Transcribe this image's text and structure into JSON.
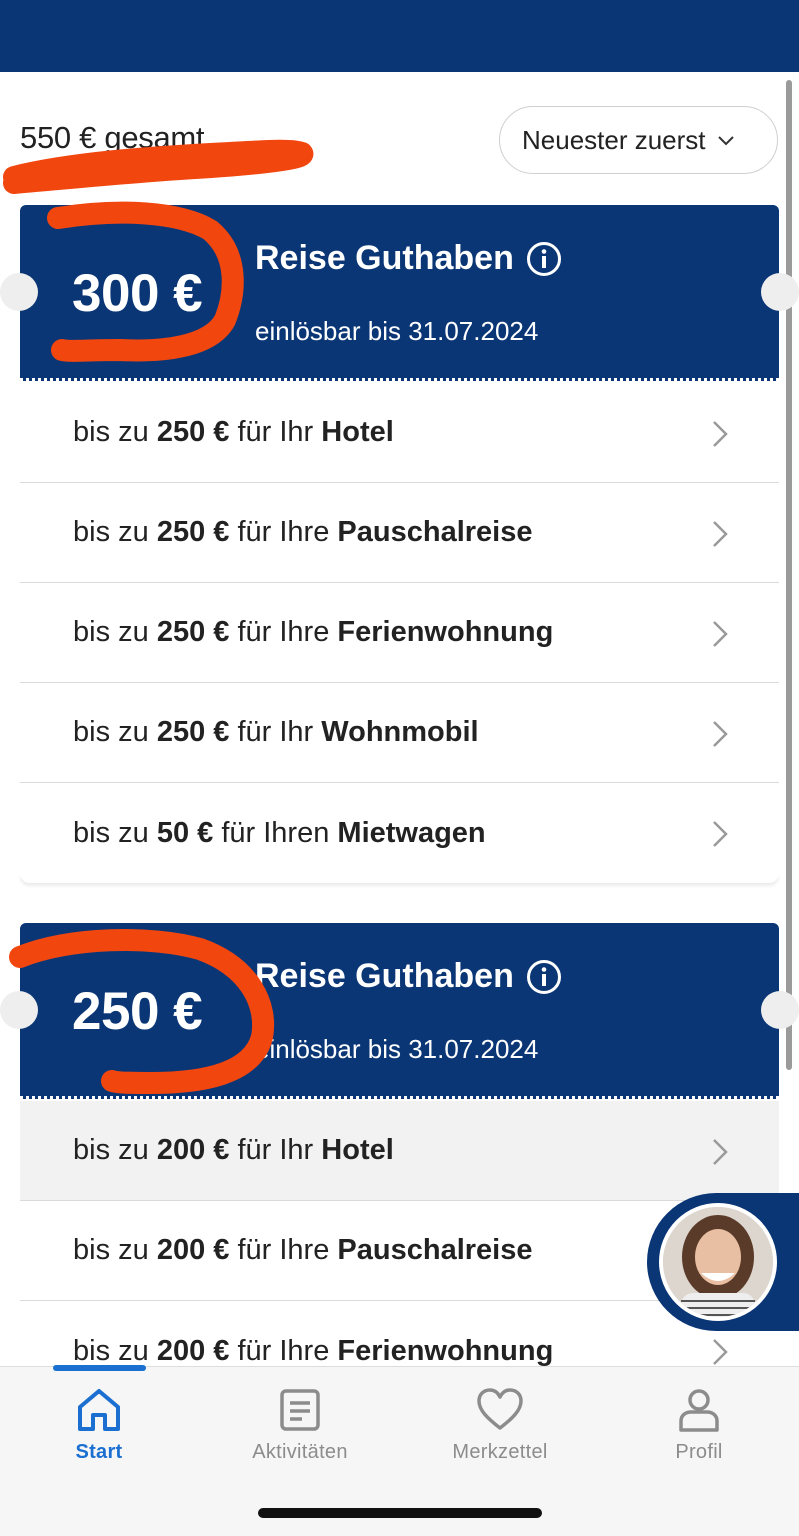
{
  "header": {
    "total": "550 € gesamt",
    "sort_label": "Neuester zuerst",
    "sort_icon": "chevron-down-icon"
  },
  "vouchers": [
    {
      "amount": "300 €",
      "title": "Reise Guthaben",
      "valid": "einlösbar bis 31.07.2024",
      "items": [
        {
          "pre": "bis zu",
          "amount": "250 €",
          "mid": "für Ihr",
          "target": "Hotel"
        },
        {
          "pre": "bis zu",
          "amount": "250 €",
          "mid": "für Ihre",
          "target": "Pauschalreise"
        },
        {
          "pre": "bis zu",
          "amount": "250 €",
          "mid": "für Ihre",
          "target": "Ferienwohnung"
        },
        {
          "pre": "bis zu",
          "amount": "250 €",
          "mid": "für Ihr",
          "target": "Wohnmobil"
        },
        {
          "pre": "bis zu",
          "amount": "50 €",
          "mid": "für Ihren",
          "target": "Mietwagen"
        }
      ]
    },
    {
      "amount": "250 €",
      "title": "Reise Guthaben",
      "valid": "einlösbar bis 31.07.2024",
      "items": [
        {
          "pre": "bis zu",
          "amount": "200 €",
          "mid": "für Ihr",
          "target": "Hotel"
        },
        {
          "pre": "bis zu",
          "amount": "200 €",
          "mid": "für Ihre",
          "target": "Pauschalreise"
        },
        {
          "pre": "bis zu",
          "amount": "200 €",
          "mid": "für Ihre",
          "target": "Ferienwohnung"
        }
      ]
    }
  ],
  "bottom_nav": [
    {
      "label": "Start",
      "icon": "home-icon",
      "active": true
    },
    {
      "label": "Aktivitäten",
      "icon": "activity-list-icon",
      "active": false
    },
    {
      "label": "Merkzettel",
      "icon": "heart-icon",
      "active": false
    },
    {
      "label": "Profil",
      "icon": "profile-icon",
      "active": false
    }
  ],
  "colors": {
    "brand_navy": "#0b3676",
    "accent_blue": "#1a6fd1",
    "annotation_orange": "#f2460f"
  }
}
